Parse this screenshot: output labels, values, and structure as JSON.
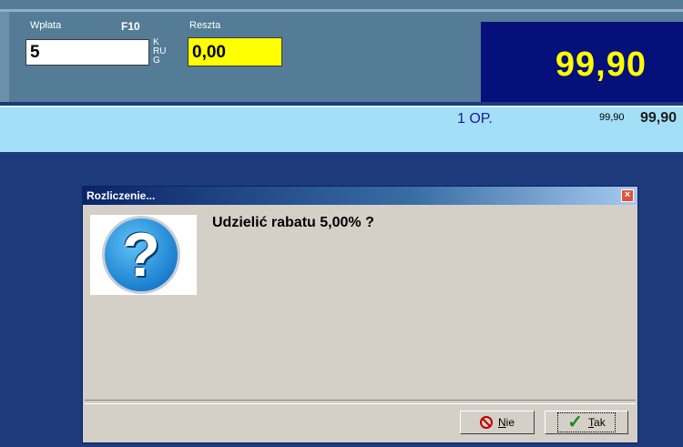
{
  "top": {
    "wplata_label": "Wpłata",
    "shortcut_label": "F10",
    "reszta_label": "Reszta",
    "wplata_value": "5",
    "kurs_lines": [
      "K",
      "RU",
      "G"
    ],
    "reszta_value": "0,00",
    "total_value": "99,90"
  },
  "item_row": {
    "op_label": "1 OP.",
    "price_small": "99,90",
    "price_large": "99,90"
  },
  "dialog": {
    "title": "Rozliczenie...",
    "message": "Udzielić rabatu 5,00% ?",
    "icon": "question-icon",
    "buttons": {
      "no_underline": "N",
      "no_rest": "ie",
      "yes_underline": "T",
      "yes_rest": "ak"
    },
    "close_glyph": "×"
  },
  "colors": {
    "background": "#1c3a7c",
    "top_panel": "#547c96",
    "total_panel": "#05107a",
    "total_text": "#ffff00",
    "reszta_box": "#ffff00",
    "item_row": "#a3dff6"
  }
}
